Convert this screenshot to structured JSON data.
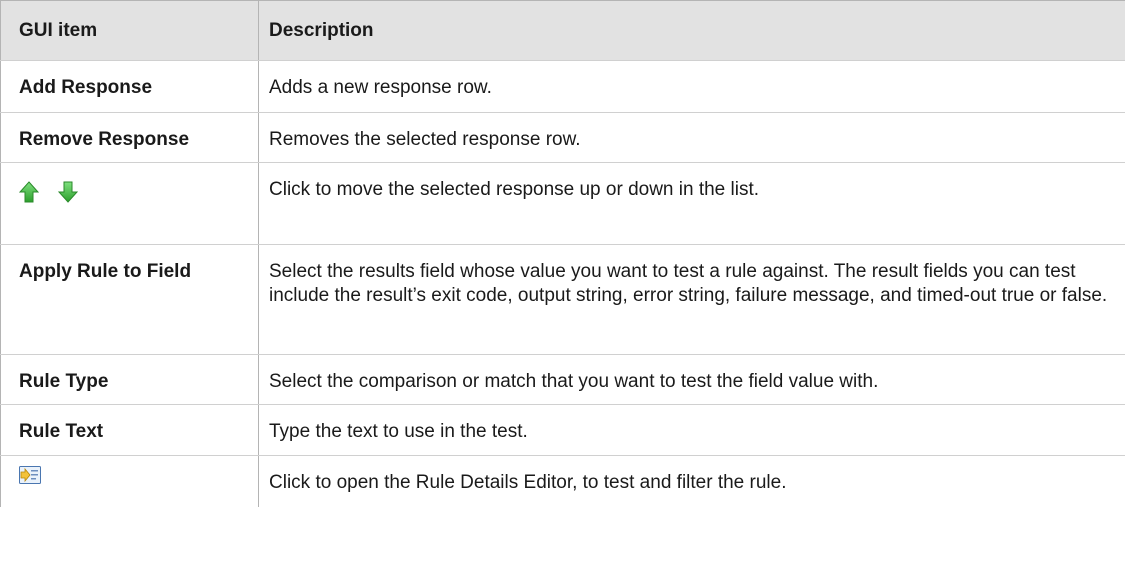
{
  "table": {
    "headers": {
      "item": "GUI item",
      "description": "Description"
    },
    "rows": [
      {
        "item": "Add Response",
        "description": "Adds a new response row."
      },
      {
        "item": "Remove Response",
        "description": "Removes the selected response row."
      },
      {
        "item_icons": [
          "up-arrow-icon",
          "down-arrow-icon"
        ],
        "description": "Click to move the selected response up or down in the list."
      },
      {
        "item": "Apply Rule to Field",
        "description": "Select the results field whose value you want to test a rule against. The result fields you can test include the result’s exit code, output string, error string, failure message, and timed-out true or false."
      },
      {
        "item": "Rule Type",
        "description": "Select the comparison or match that you want to test the field value with."
      },
      {
        "item": "Rule Text",
        "description": "Type the text to use in the test."
      },
      {
        "item_icons": [
          "rule-details-editor-icon"
        ],
        "description": "Click to open the Rule Details Editor, to test and filter the rule."
      }
    ]
  },
  "colors": {
    "header_background": "#e2e2e2",
    "border": "#b4b4b4",
    "arrow_green": "#3db33d"
  }
}
